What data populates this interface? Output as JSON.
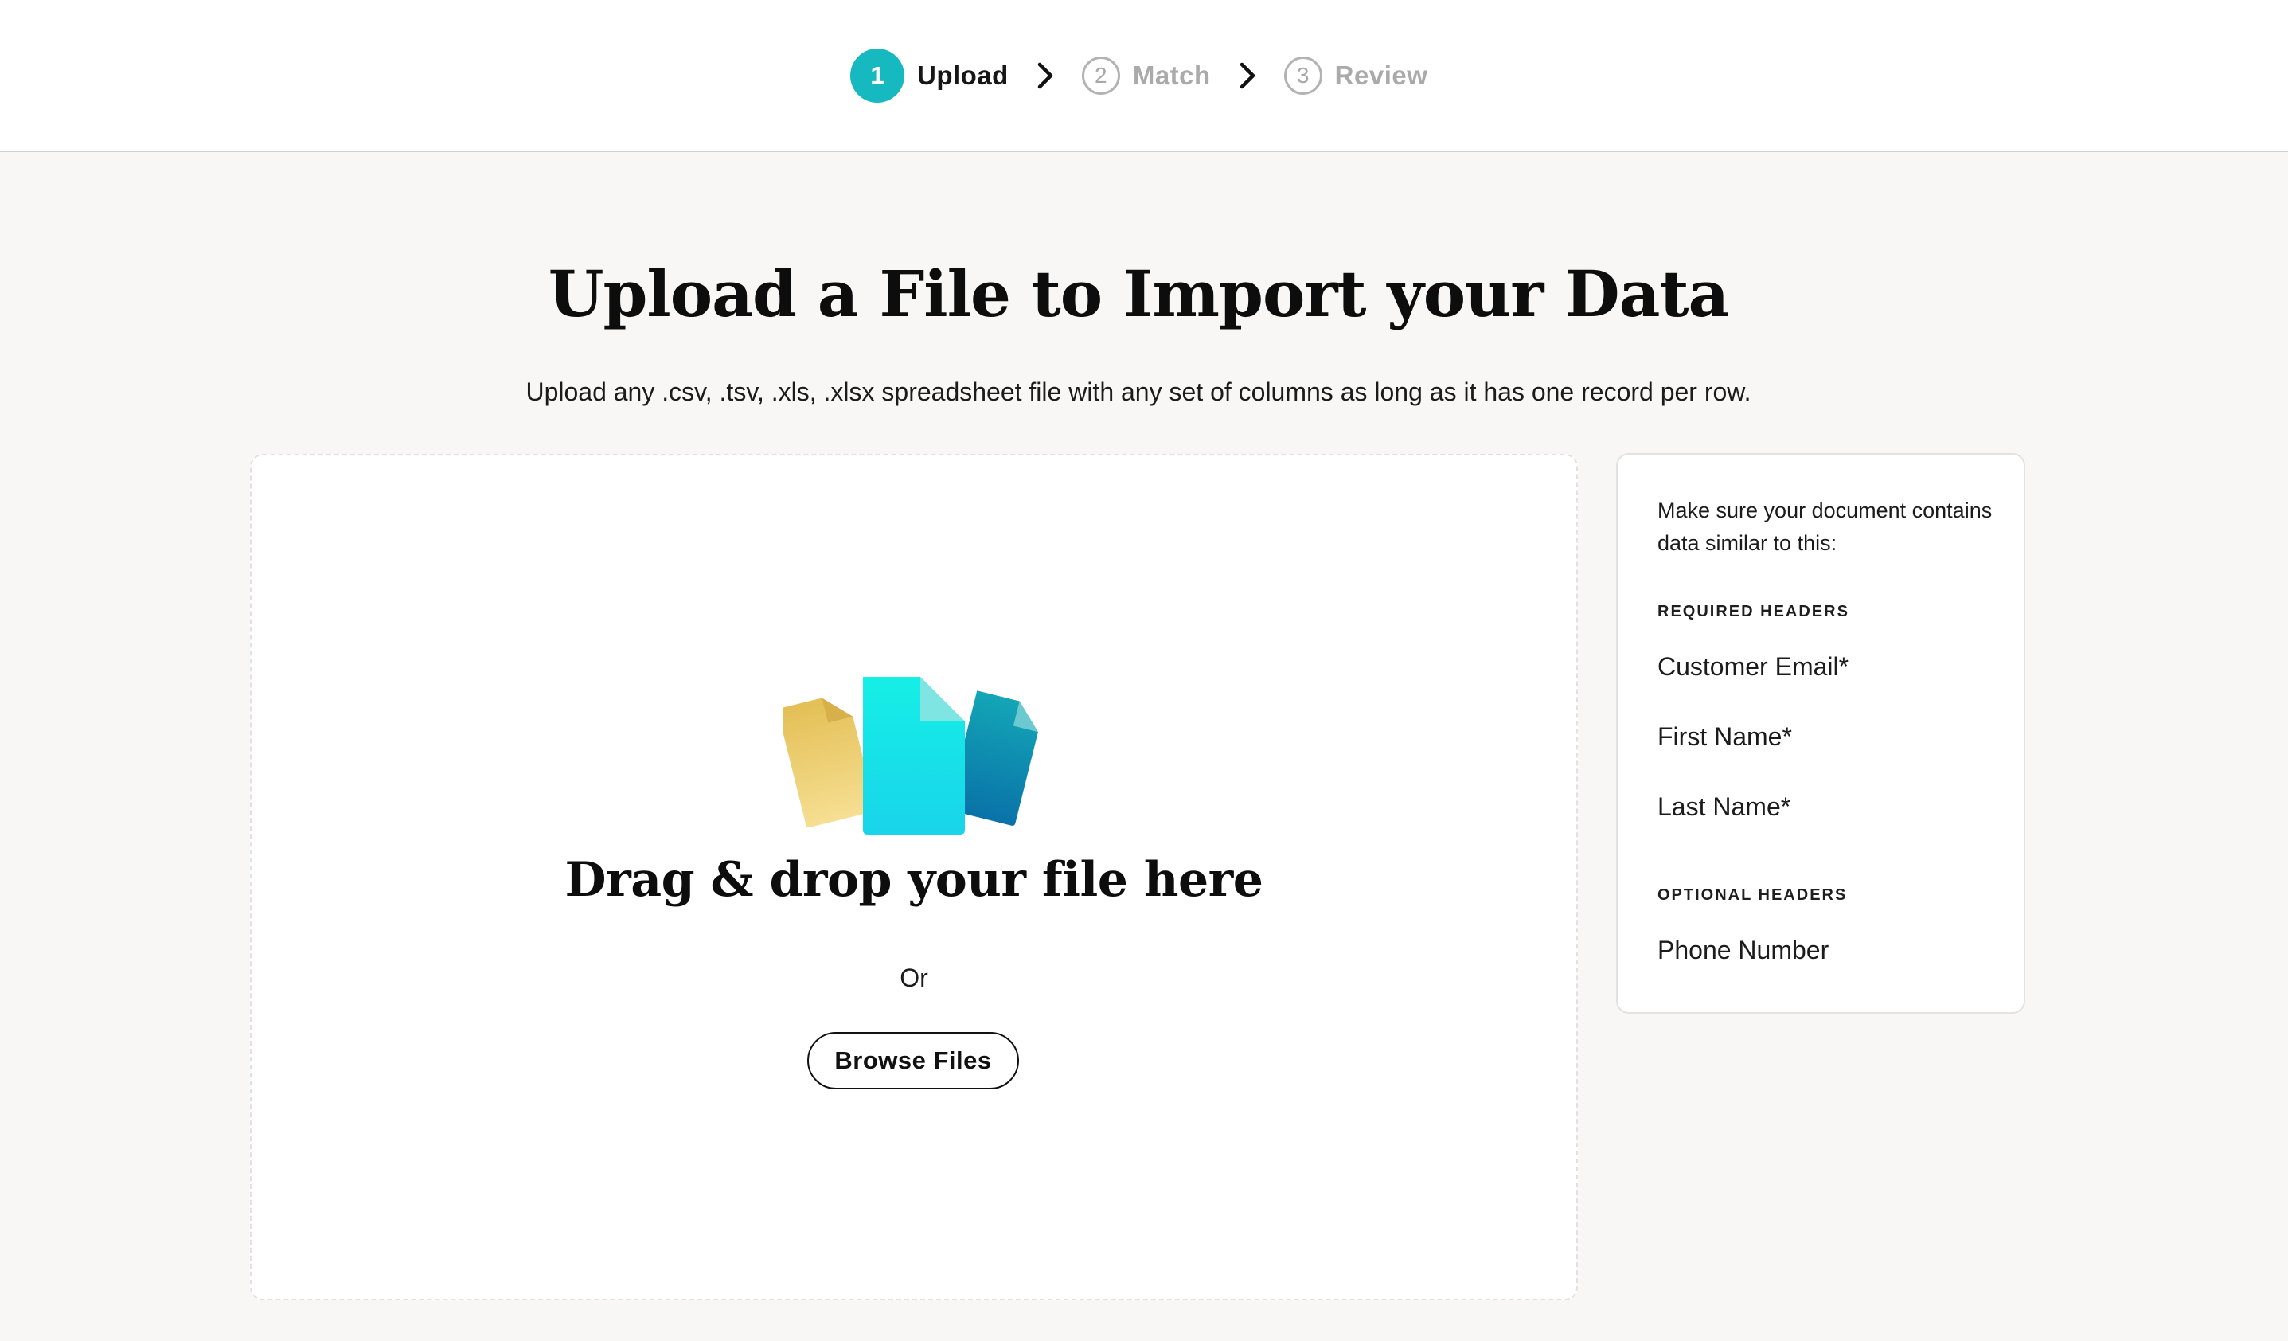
{
  "stepper": {
    "steps": [
      {
        "number": "1",
        "label": "Upload",
        "state": "active"
      },
      {
        "number": "2",
        "label": "Match",
        "state": "inactive"
      },
      {
        "number": "3",
        "label": "Review",
        "state": "inactive"
      }
    ],
    "separator_icon": "chevron-right-icon",
    "accent_color": "#16b9bf"
  },
  "main": {
    "title": "Upload a File to Import your Data",
    "subtitle": "Upload any .csv, .tsv, .xls, .xlsx spreadsheet file with any set of columns as long as it has one record per row."
  },
  "dropzone": {
    "illustration_icon": "files-icon",
    "title": "Drag & drop your file here",
    "or_text": "Or",
    "browse_label": "Browse Files"
  },
  "hints": {
    "intro": "Make sure your document contains data similar to this:",
    "required_heading": "REQUIRED HEADERS",
    "required_fields": [
      "Customer Email*",
      "First Name*",
      "Last Name*"
    ],
    "optional_heading": "OPTIONAL HEADERS",
    "optional_fields": [
      "Phone Number"
    ]
  }
}
